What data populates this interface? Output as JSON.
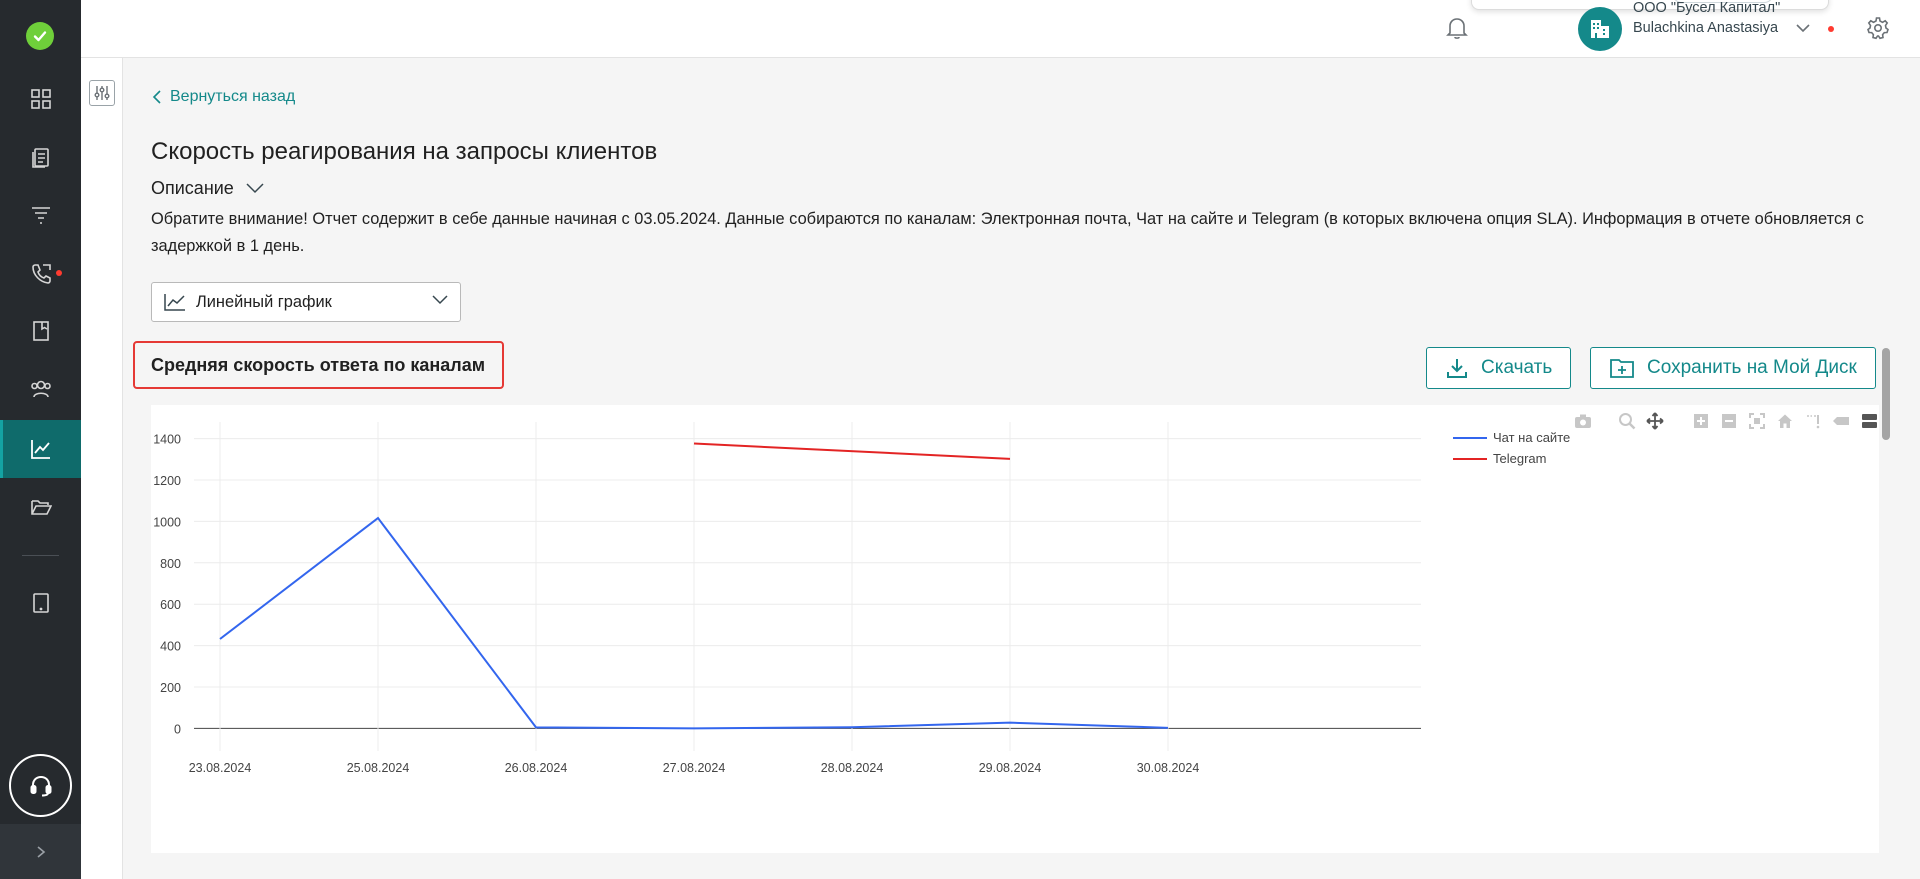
{
  "header": {
    "company_name": "ООО \"Бусел Капитал\"",
    "user_name": "Bulachkina Anastasiya",
    "icons": [
      "bell-icon",
      "building-icon",
      "chevron-down-icon",
      "gear-icon",
      "logout-icon"
    ],
    "notification_color": "#ff3b30"
  },
  "sidebar": {
    "items": [
      {
        "name": "dashboard-grid-icon"
      },
      {
        "name": "documents-icon"
      },
      {
        "name": "funnel-icon"
      },
      {
        "name": "phone-icon",
        "has_badge": true
      },
      {
        "name": "book-icon"
      },
      {
        "name": "users-icon"
      },
      {
        "name": "analytics-chart-icon",
        "active": true
      },
      {
        "name": "folder-icon"
      },
      {
        "name": "tablet-icon"
      }
    ],
    "accent": "#14898a",
    "active_bg": "#0f6b6b"
  },
  "page": {
    "back_label": "Вернуться назад",
    "title": "Скорость реагирования на запросы клиентов",
    "description_toggle": "Описание",
    "description_text": "Обратите внимание! Отчет содержит в себе данные начиная с 03.05.2024. Данные собираются по каналам: Электронная почта, Чат на сайте и Telegram (в которых включена опция SLA). Информация в отчете обновляется с задержкой в 1 день.",
    "chart_type_select": "Линейный график",
    "chart_heading": "Средняя скорость ответа по каналам",
    "download_label": "Скачать",
    "save_label": "Сохранить на Мой Диск"
  },
  "chart_data": {
    "type": "line",
    "title": "",
    "xlabel": "",
    "ylabel": "",
    "categories": [
      "23.08.2024",
      "25.08.2024",
      "26.08.2024",
      "27.08.2024",
      "28.08.2024",
      "29.08.2024",
      "30.08.2024"
    ],
    "yticks": [
      0,
      200,
      400,
      600,
      800,
      1000,
      1200,
      1400
    ],
    "ylim": [
      -80,
      1480
    ],
    "grid": true,
    "legend_position": "top-right",
    "series": [
      {
        "name": "Чат на сайте",
        "color": "#3366ee",
        "values": [
          432,
          1016,
          5,
          0,
          6,
          28,
          3
        ]
      },
      {
        "name": "Telegram",
        "color": "#e32424",
        "values": [
          null,
          null,
          null,
          1376,
          null,
          1302,
          null
        ]
      }
    ]
  }
}
